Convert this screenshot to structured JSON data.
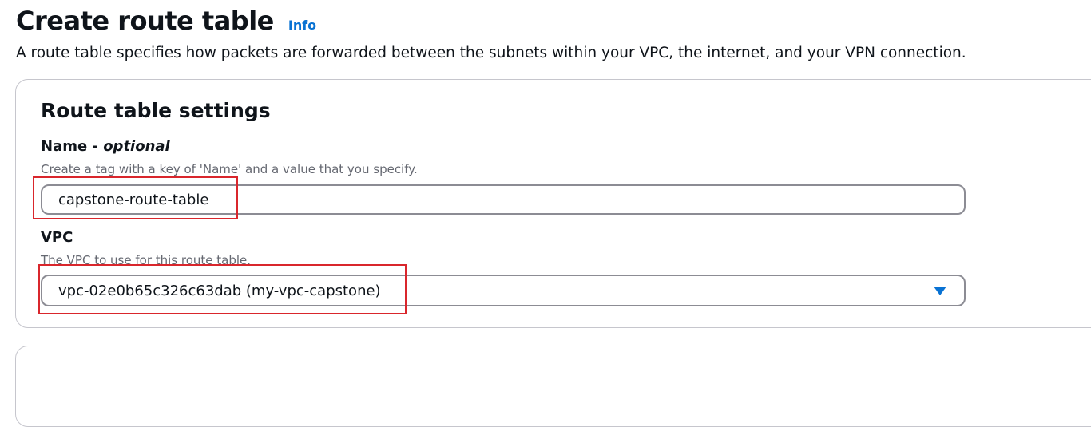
{
  "header": {
    "title": "Create route table",
    "info_label": "Info",
    "description": "A route table specifies how packets are forwarded between the subnets within your VPC, the internet, and your VPN connection."
  },
  "settings": {
    "section_title": "Route table settings",
    "name_field": {
      "label": "Name",
      "optional": " - optional",
      "description": "Create a tag with a key of 'Name' and a value that you specify.",
      "value": "capstone-route-table"
    },
    "vpc_field": {
      "label": "VPC",
      "description": "The VPC to use for this route table.",
      "selected": "vpc-02e0b65c326c63dab (my-vpc-capstone)"
    }
  },
  "colors": {
    "link": "#0972d3",
    "highlight": "#d9262c",
    "input_border": "#8c8c94",
    "container_border": "#c6c6cd"
  },
  "icons": {
    "vpc_dropdown": "caret-down-icon"
  }
}
